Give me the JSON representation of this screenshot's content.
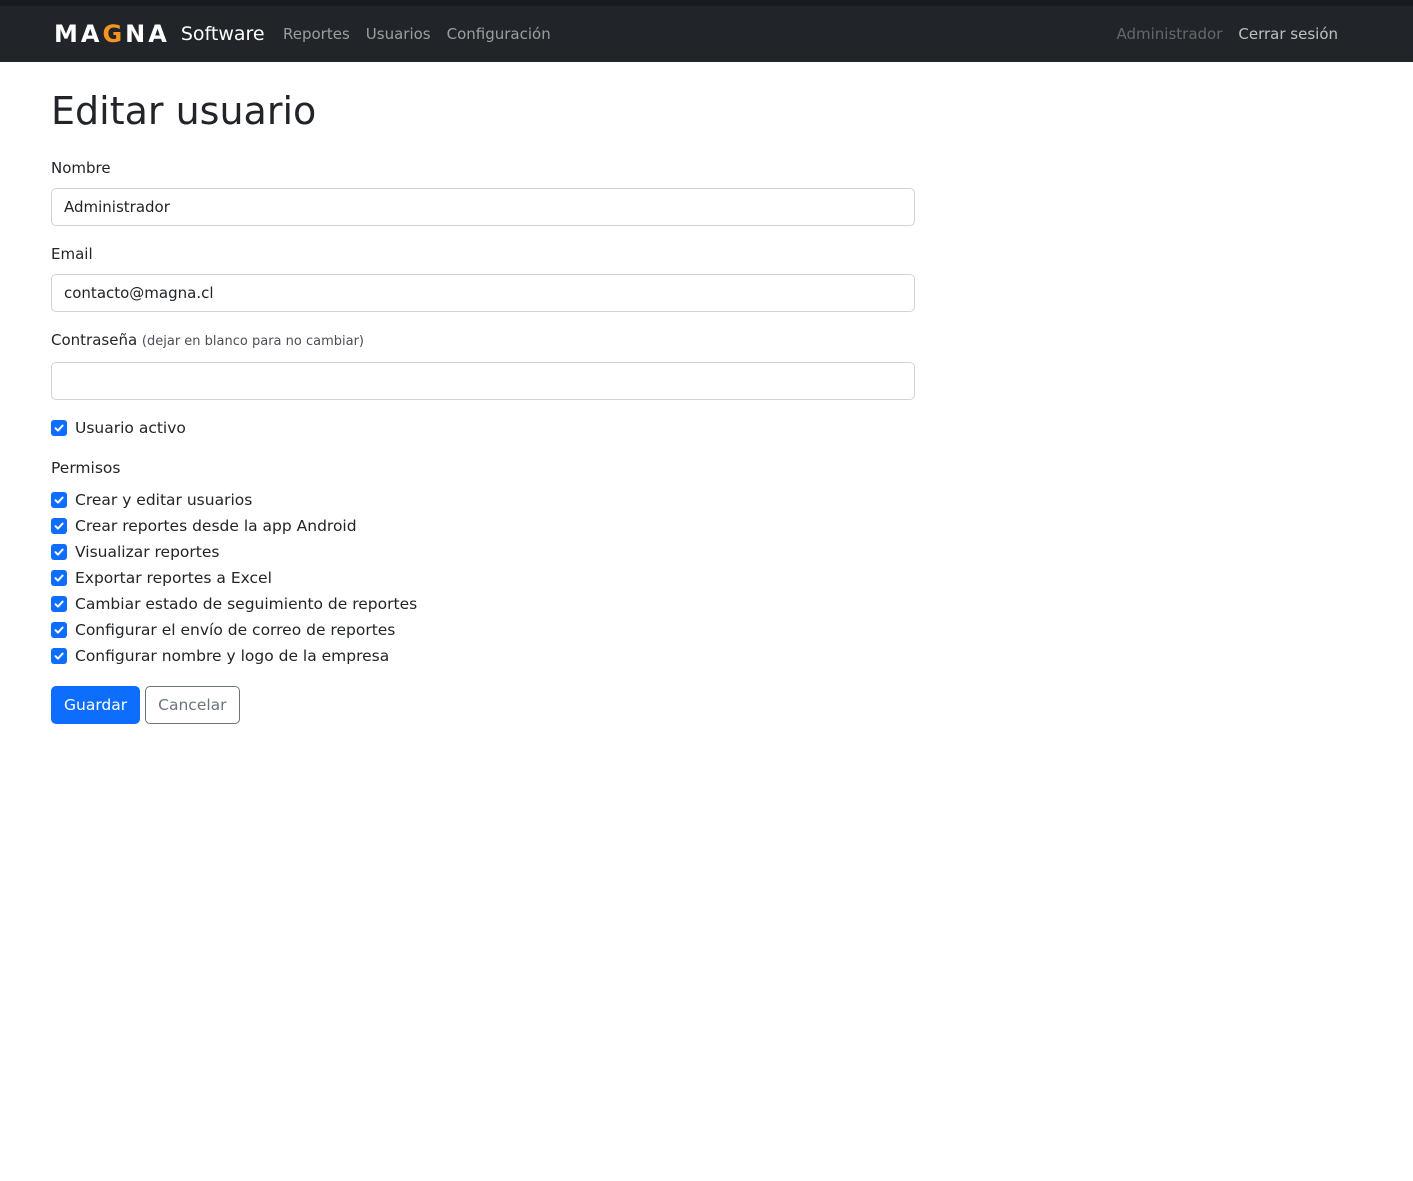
{
  "navbar": {
    "logo_letters": [
      "M",
      "A",
      "G",
      "N",
      "A"
    ],
    "brand_text": "Software",
    "links": [
      "Reportes",
      "Usuarios",
      "Configuración"
    ],
    "user_name": "Administrador",
    "logout_label": "Cerrar sesión",
    "logo_accent_color": "#f7941d",
    "background_color": "#212529"
  },
  "page": {
    "title": "Editar usuario"
  },
  "form": {
    "name_label": "Nombre",
    "name_value": "Administrador",
    "email_label": "Email",
    "email_value": "contacto@magna.cl",
    "password_label": "Contraseña",
    "password_hint": "(dejar en blanco para no cambiar)",
    "password_value": "",
    "active_label": "Usuario activo",
    "active_checked": true,
    "permissions_title": "Permisos",
    "permissions": [
      {
        "label": "Crear y editar usuarios",
        "checked": true
      },
      {
        "label": "Crear reportes desde la app Android",
        "checked": true
      },
      {
        "label": "Visualizar reportes",
        "checked": true
      },
      {
        "label": "Exportar reportes a Excel",
        "checked": true
      },
      {
        "label": "Cambiar estado de seguimiento de reportes",
        "checked": true
      },
      {
        "label": "Configurar el envío de correo de reportes",
        "checked": true
      },
      {
        "label": "Configurar nombre y logo de la empresa",
        "checked": true
      }
    ],
    "save_label": "Guardar",
    "cancel_label": "Cancelar",
    "primary_color": "#0d6efd"
  }
}
